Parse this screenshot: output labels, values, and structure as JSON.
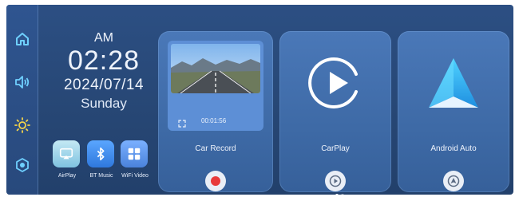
{
  "clock": {
    "ampm": "AM",
    "time": "02:28",
    "date": "2024/07/14",
    "day": "Sunday"
  },
  "sidebar": {
    "items": [
      {
        "icon": "home-icon"
      },
      {
        "icon": "volume-icon"
      },
      {
        "icon": "brightness-icon"
      },
      {
        "icon": "settings-icon"
      }
    ]
  },
  "apps": [
    {
      "label": "AirPlay",
      "icon": "airplay-icon",
      "color": "#9fd3e8"
    },
    {
      "label": "BT Music",
      "icon": "bluetooth-icon",
      "color": "#3f8ae8"
    },
    {
      "label": "WiFi Video",
      "icon": "grid-icon",
      "color": "#5b8fe0"
    }
  ],
  "cards": [
    {
      "title": "Car Record",
      "timestamp": "00:01:56",
      "button_icon": "record-icon",
      "button_color": "#e83a3a"
    },
    {
      "title": "CarPlay",
      "button_icon": "carplay-icon"
    },
    {
      "title": "Android Auto",
      "button_icon": "android-auto-icon"
    }
  ],
  "page_indicator": {
    "count": 2,
    "active": 0
  },
  "colors": {
    "screen_bg": "#274775",
    "card_bg": "#4a78b8",
    "text": "#eef3fb",
    "record_red": "#e83a3a"
  }
}
